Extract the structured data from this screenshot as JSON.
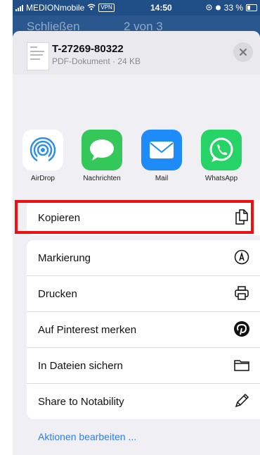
{
  "status_bar": {
    "carrier": "MEDIONmobile",
    "vpn": "VPN",
    "time": "14:50",
    "battery": "33 %"
  },
  "background_nav": {
    "left_label": "Schließen",
    "center_label": "2 von 3"
  },
  "document": {
    "title": "T-27269-80322",
    "subtitle": "PDF-Dokument · 24 KB"
  },
  "apps": [
    {
      "label": "AirDrop",
      "icon": "airdrop-icon"
    },
    {
      "label": "Nachrichten",
      "icon": "messages-icon"
    },
    {
      "label": "Mail",
      "icon": "mail-icon"
    },
    {
      "label": "WhatsApp",
      "icon": "whatsapp-icon"
    }
  ],
  "actions_primary": [
    {
      "label": "Kopieren",
      "icon": "copy-icon"
    }
  ],
  "actions": [
    {
      "label": "Markierung",
      "icon": "markup-icon"
    },
    {
      "label": "Drucken",
      "icon": "printer-icon"
    },
    {
      "label": "Auf Pinterest merken",
      "icon": "pinterest-icon"
    },
    {
      "label": "In Dateien sichern",
      "icon": "folder-icon"
    },
    {
      "label": "Share to Notability",
      "icon": "pencil-icon"
    }
  ],
  "edit_actions_label": "Aktionen bearbeiten ...",
  "colors": {
    "highlight": "#ee1111",
    "link": "#2f7ff0",
    "messages": "#34c759",
    "mail": "#1d8cf8",
    "whatsapp": "#25d366"
  }
}
